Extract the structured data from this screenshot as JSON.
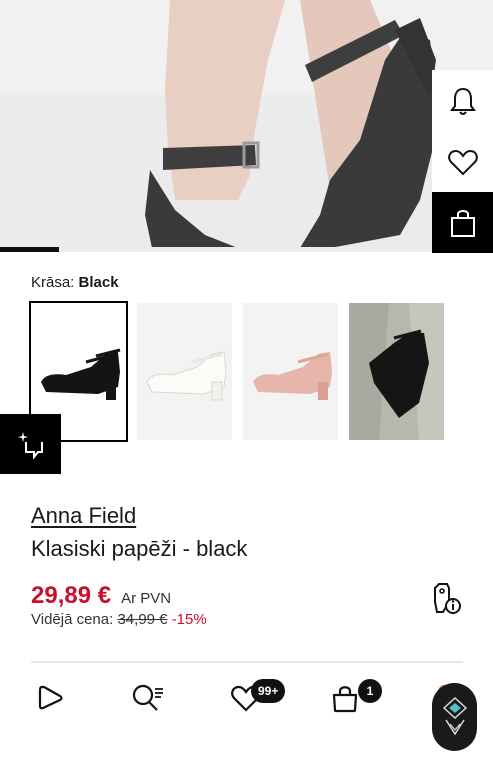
{
  "hero": {
    "progress_fraction": 0.12
  },
  "side_actions": [
    {
      "icon": "bell-icon"
    },
    {
      "icon": "heart-icon"
    },
    {
      "icon": "shopping-bag-icon"
    }
  ],
  "color": {
    "label": "Krāsa:",
    "value": "Black"
  },
  "swatches": [
    {
      "color": "black",
      "selected": true
    },
    {
      "color": "white",
      "selected": false
    },
    {
      "color": "pink",
      "selected": false
    },
    {
      "color": "black-photo",
      "selected": false
    }
  ],
  "product": {
    "brand": "Anna Field",
    "name": "Klasiski papēži - black",
    "price": "29,89 €",
    "vat_label": "Ar PVN",
    "avg_label": "Vidējā cena:",
    "old_price": "34,99 €",
    "discount": "-15%"
  },
  "nav": {
    "items": [
      {
        "icon": "play-icon"
      },
      {
        "icon": "search-list-icon"
      },
      {
        "icon": "heart-icon",
        "badge": "99+"
      },
      {
        "icon": "shopping-bag-icon",
        "badge": "1"
      },
      {
        "icon": "profile-icon"
      }
    ]
  },
  "colors": {
    "price_red": "#c8102e",
    "black": "#000000"
  }
}
